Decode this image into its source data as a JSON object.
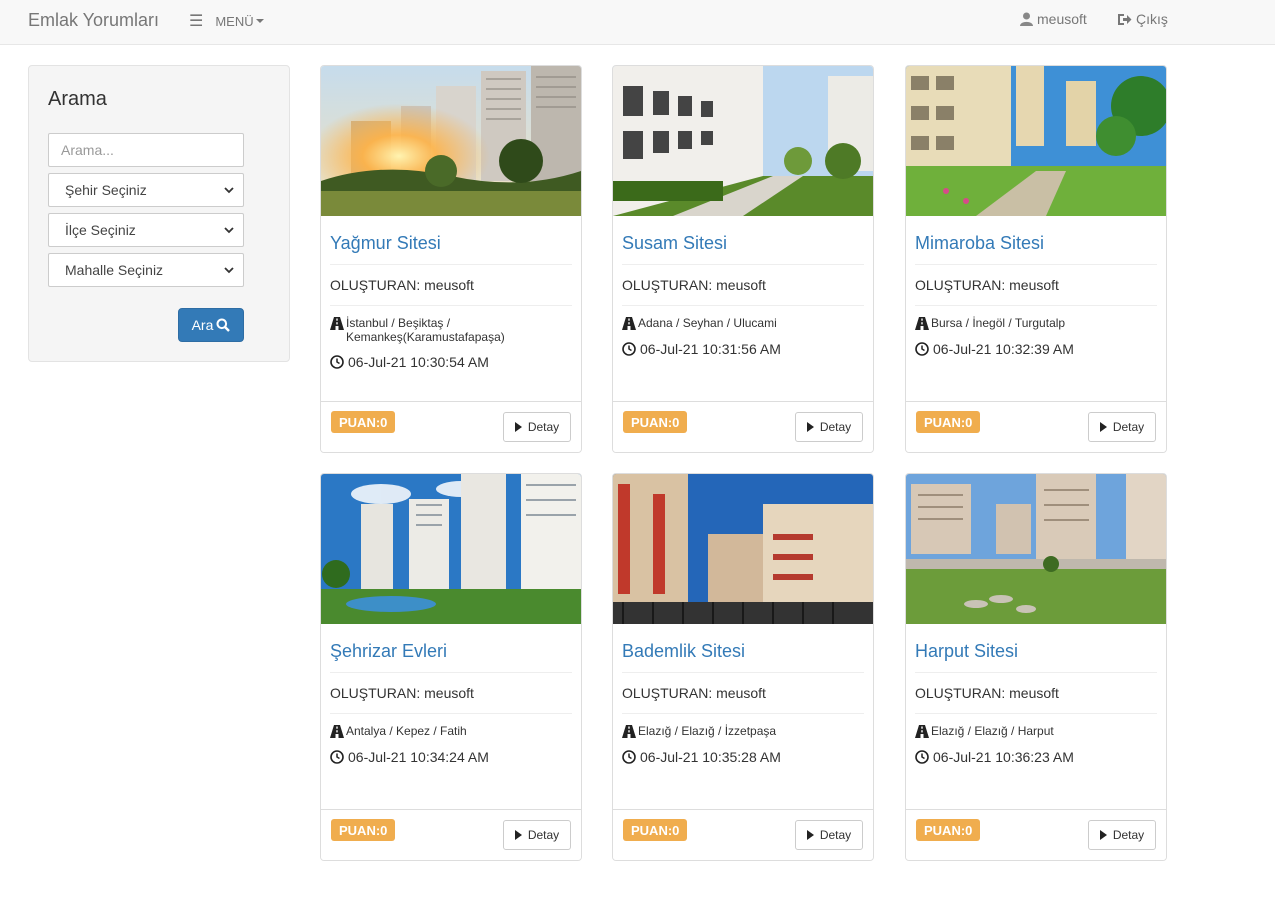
{
  "navbar": {
    "brand": "Emlak Yorumları",
    "menu_label": "MENÜ",
    "user": "meusoft",
    "logout": "Çıkış"
  },
  "search": {
    "title": "Arama",
    "placeholder": "Arama...",
    "city": "Şehir Seçiniz",
    "district": "İlçe Seçiniz",
    "neighborhood": "Mahalle Seçiniz",
    "button": "Ara"
  },
  "cards": [
    {
      "title": "Yağmur Sitesi",
      "creator": "OLUŞTURAN: meusoft",
      "location": "İstanbul / Beşiktaş / Kemankeş(Karamustafapaşa)",
      "date": "06-Jul-21 10:30:54 AM",
      "score": "PUAN:0",
      "button": "Detay"
    },
    {
      "title": "Susam Sitesi",
      "creator": "OLUŞTURAN: meusoft",
      "location": "Adana / Seyhan / Ulucami",
      "date": "06-Jul-21 10:31:56 AM",
      "score": "PUAN:0",
      "button": "Detay"
    },
    {
      "title": "Mimaroba Sitesi",
      "creator": "OLUŞTURAN: meusoft",
      "location": "Bursa / İnegöl / Turgutalp",
      "date": "06-Jul-21 10:32:39 AM",
      "score": "PUAN:0",
      "button": "Detay"
    },
    {
      "title": "Şehrizar Evleri",
      "creator": "OLUŞTURAN: meusoft",
      "location": "Antalya / Kepez / Fatih",
      "date": "06-Jul-21 10:34:24 AM",
      "score": "PUAN:0",
      "button": "Detay"
    },
    {
      "title": "Bademlik Sitesi",
      "creator": "OLUŞTURAN: meusoft",
      "location": "Elazığ / Elazığ / İzzetpaşa",
      "date": "06-Jul-21 10:35:28 AM",
      "score": "PUAN:0",
      "button": "Detay"
    },
    {
      "title": "Harput Sitesi",
      "creator": "OLUŞTURAN: meusoft",
      "location": "Elazığ / Elazığ / Harput",
      "date": "06-Jul-21 10:36:23 AM",
      "score": "PUAN:0",
      "button": "Detay"
    }
  ],
  "colors": {
    "link": "#337ab7",
    "badge": "#f0ad4e",
    "primary_button": "#337ab7"
  }
}
